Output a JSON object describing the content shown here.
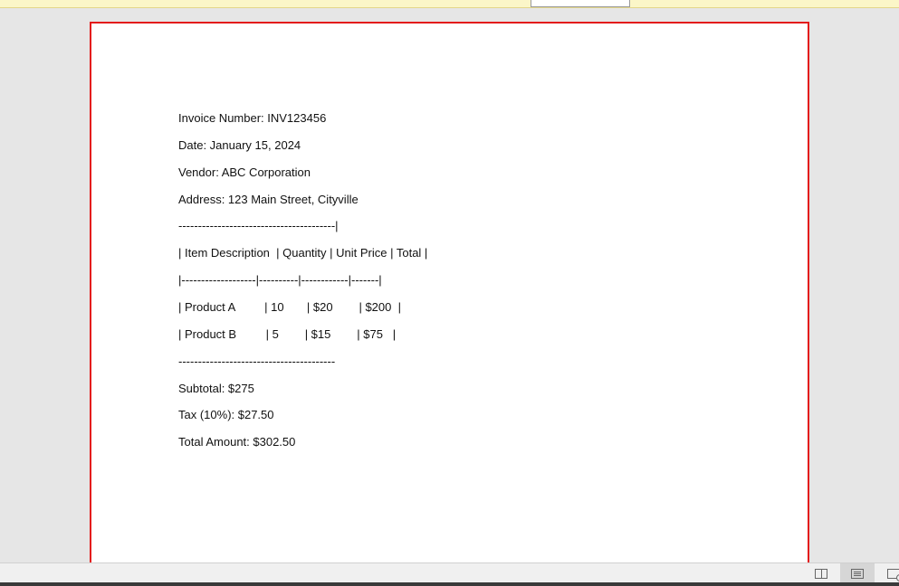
{
  "document": {
    "lines": [
      "Invoice Number: INV123456",
      "Date: January 15, 2024",
      "Vendor: ABC Corporation",
      "Address: 123 Main Street, Cityville",
      "----------------------------------------|",
      "| Item Description  | Quantity | Unit Price | Total |",
      "|-------------------|----------|------------|-------|",
      "| Product A         | 10       | $20        | $200  |",
      "| Product B         | 5        | $15        | $75   |",
      "----------------------------------------",
      "Subtotal: $275",
      "Tax (10%): $27.50",
      "Total Amount: $302.50"
    ]
  },
  "statusbar": {
    "views": [
      {
        "name": "read-mode",
        "icon": "book-icon",
        "active": false
      },
      {
        "name": "print-layout",
        "icon": "page-icon",
        "active": true
      },
      {
        "name": "web-layout",
        "icon": "web-page-icon",
        "active": false
      }
    ]
  },
  "colors": {
    "page_border": "#e31b1b",
    "canvas": "#e6e6e6",
    "notification_bar": "#fbf6c8"
  }
}
